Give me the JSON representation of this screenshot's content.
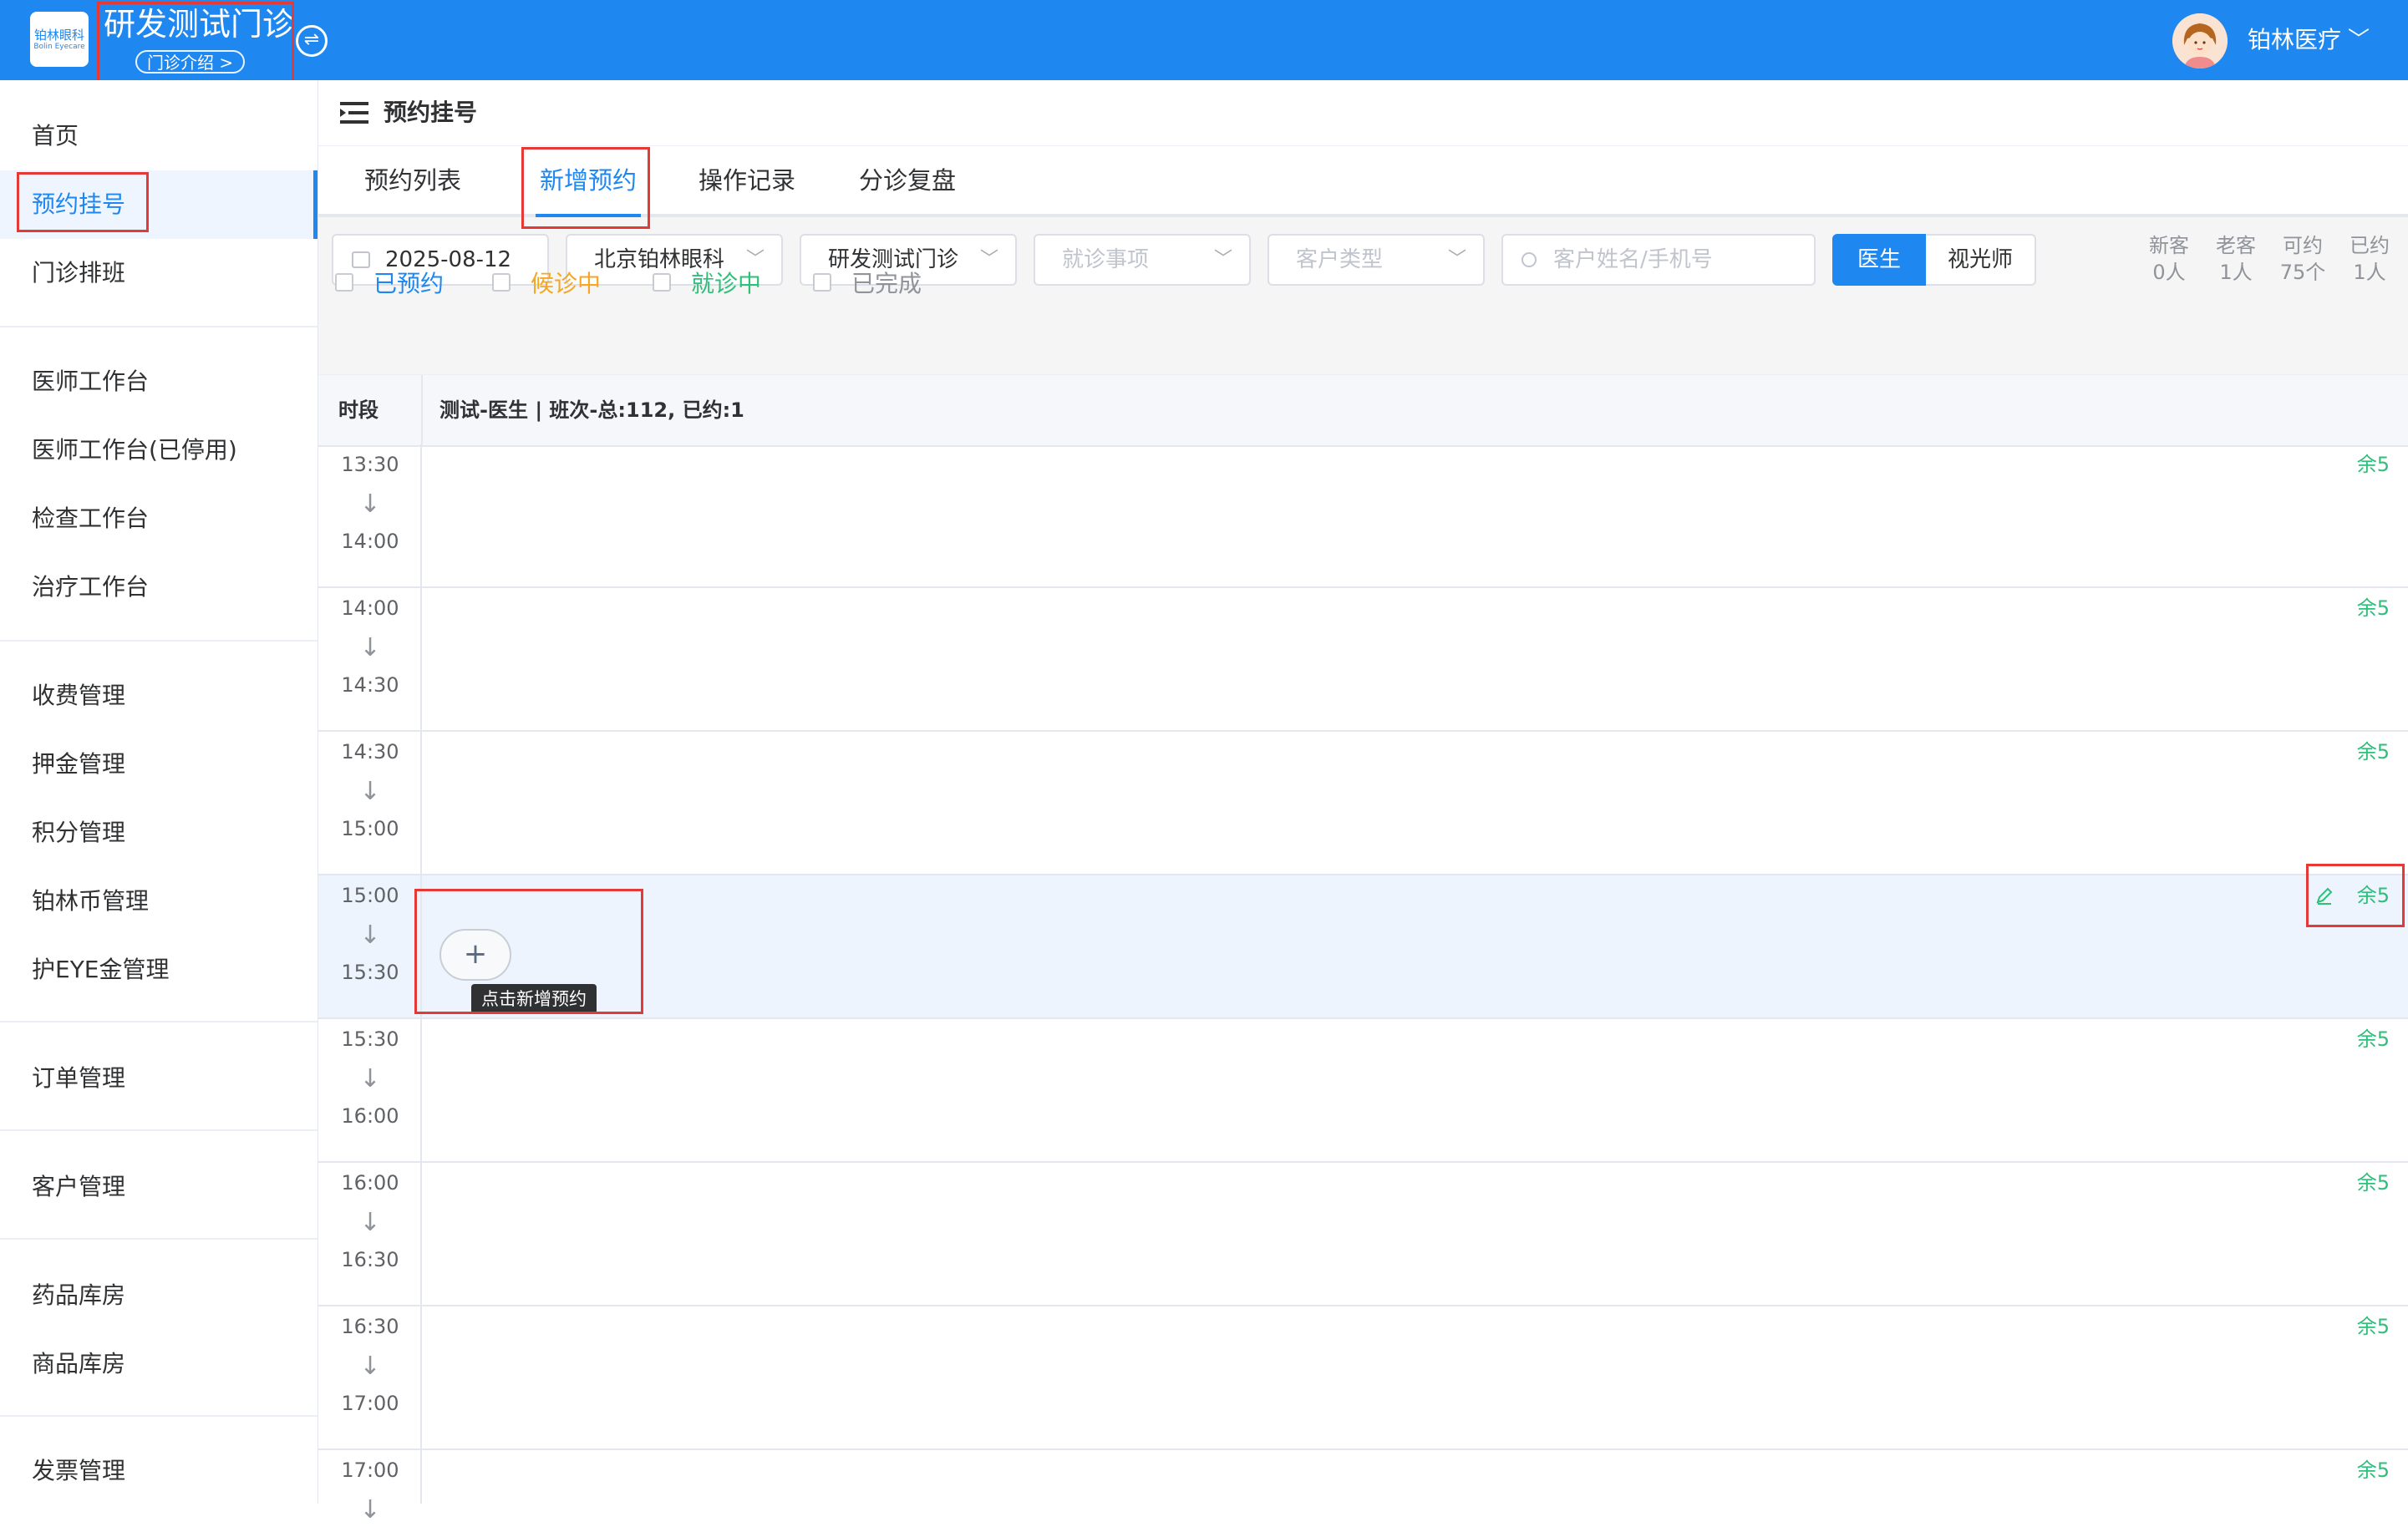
{
  "header": {
    "logo_text": "铂林眼科",
    "logo_sub": "Bolin Eyecare",
    "clinic_name": "研发测试门诊",
    "clinic_intro": "门诊介绍 >",
    "user_name": "铂林医疗",
    "user_chevron": "﹀"
  },
  "sidebar": {
    "items": [
      {
        "label": "首页"
      },
      {
        "label": "预约挂号",
        "active": true
      },
      {
        "label": "门诊排班"
      },
      {
        "label": "医师工作台"
      },
      {
        "label": "医师工作台(已停用)"
      },
      {
        "label": "检查工作台"
      },
      {
        "label": "治疗工作台"
      },
      {
        "label": "收费管理"
      },
      {
        "label": "押金管理"
      },
      {
        "label": "积分管理"
      },
      {
        "label": "铂林币管理"
      },
      {
        "label": "护EYE金管理"
      },
      {
        "label": "订单管理"
      },
      {
        "label": "客户管理"
      },
      {
        "label": "药品库房"
      },
      {
        "label": "商品库房"
      },
      {
        "label": "发票管理"
      }
    ]
  },
  "page": {
    "title": "预约挂号",
    "tabs": [
      {
        "label": "预约列表"
      },
      {
        "label": "新增预约",
        "active": true
      },
      {
        "label": "操作记录"
      },
      {
        "label": "分诊复盘"
      }
    ]
  },
  "filters": {
    "date": "2025-08-12",
    "hospital": "北京铂林眼科",
    "clinic": "研发测试门诊",
    "visit_item_placeholder": "就诊事项",
    "customer_type_placeholder": "客户类型",
    "search_placeholder": "客户姓名/手机号",
    "role_toggle": [
      {
        "label": "医生",
        "active": true
      },
      {
        "label": "视光师"
      }
    ],
    "stats": [
      {
        "label": "新客",
        "value": "0人"
      },
      {
        "label": "老客",
        "value": "1人"
      },
      {
        "label": "可约",
        "value": "75个"
      },
      {
        "label": "已约",
        "value": "1人"
      }
    ],
    "status_checkboxes": [
      {
        "label": "已预约",
        "color": "#1e87f0"
      },
      {
        "label": "候诊中",
        "color": "#f5a623"
      },
      {
        "label": "就诊中",
        "color": "#2ebf7a"
      },
      {
        "label": "已完成",
        "color": "#909399"
      }
    ]
  },
  "schedule": {
    "time_header": "时段",
    "doctor_header": "测试-医生 | 班次-总:112, 已约:1",
    "arrow": "↓",
    "slots": [
      {
        "start": "13:30",
        "end": "14:00",
        "remaining": "余5"
      },
      {
        "start": "14:00",
        "end": "14:30",
        "remaining": "余5"
      },
      {
        "start": "14:30",
        "end": "15:00",
        "remaining": "余5"
      },
      {
        "start": "15:00",
        "end": "15:30",
        "remaining": "余5",
        "hovered": true
      },
      {
        "start": "15:30",
        "end": "16:00",
        "remaining": "余5"
      },
      {
        "start": "16:00",
        "end": "16:30",
        "remaining": "余5"
      },
      {
        "start": "16:30",
        "end": "17:00",
        "remaining": "余5"
      },
      {
        "start": "17:00",
        "end": "",
        "remaining": "余5"
      }
    ],
    "add_button": "+",
    "add_tooltip": "点击新增预约"
  },
  "colors": {
    "brand": "#1e87f0",
    "remaining": "#2ebf7a",
    "annotation": "#e53935",
    "hover_row": "#edf4fd"
  }
}
